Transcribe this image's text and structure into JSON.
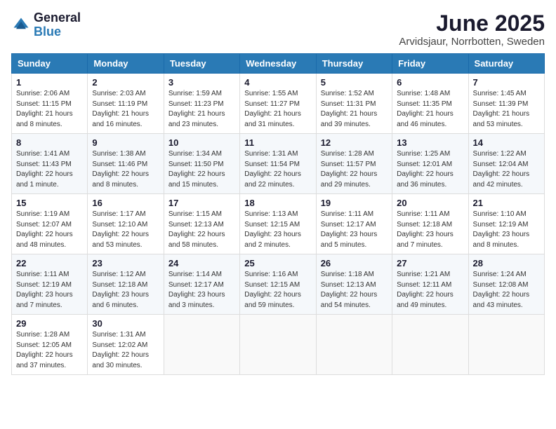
{
  "logo": {
    "general": "General",
    "blue": "Blue"
  },
  "title": "June 2025",
  "location": "Arvidsjaur, Norrbotten, Sweden",
  "days_of_week": [
    "Sunday",
    "Monday",
    "Tuesday",
    "Wednesday",
    "Thursday",
    "Friday",
    "Saturday"
  ],
  "weeks": [
    [
      {
        "day": "1",
        "sunrise": "Sunrise: 2:06 AM",
        "sunset": "Sunset: 11:15 PM",
        "daylight": "Daylight: 21 hours and 8 minutes."
      },
      {
        "day": "2",
        "sunrise": "Sunrise: 2:03 AM",
        "sunset": "Sunset: 11:19 PM",
        "daylight": "Daylight: 21 hours and 16 minutes."
      },
      {
        "day": "3",
        "sunrise": "Sunrise: 1:59 AM",
        "sunset": "Sunset: 11:23 PM",
        "daylight": "Daylight: 21 hours and 23 minutes."
      },
      {
        "day": "4",
        "sunrise": "Sunrise: 1:55 AM",
        "sunset": "Sunset: 11:27 PM",
        "daylight": "Daylight: 21 hours and 31 minutes."
      },
      {
        "day": "5",
        "sunrise": "Sunrise: 1:52 AM",
        "sunset": "Sunset: 11:31 PM",
        "daylight": "Daylight: 21 hours and 39 minutes."
      },
      {
        "day": "6",
        "sunrise": "Sunrise: 1:48 AM",
        "sunset": "Sunset: 11:35 PM",
        "daylight": "Daylight: 21 hours and 46 minutes."
      },
      {
        "day": "7",
        "sunrise": "Sunrise: 1:45 AM",
        "sunset": "Sunset: 11:39 PM",
        "daylight": "Daylight: 21 hours and 53 minutes."
      }
    ],
    [
      {
        "day": "8",
        "sunrise": "Sunrise: 1:41 AM",
        "sunset": "Sunset: 11:43 PM",
        "daylight": "Daylight: 22 hours and 1 minute."
      },
      {
        "day": "9",
        "sunrise": "Sunrise: 1:38 AM",
        "sunset": "Sunset: 11:46 PM",
        "daylight": "Daylight: 22 hours and 8 minutes."
      },
      {
        "day": "10",
        "sunrise": "Sunrise: 1:34 AM",
        "sunset": "Sunset: 11:50 PM",
        "daylight": "Daylight: 22 hours and 15 minutes."
      },
      {
        "day": "11",
        "sunrise": "Sunrise: 1:31 AM",
        "sunset": "Sunset: 11:54 PM",
        "daylight": "Daylight: 22 hours and 22 minutes."
      },
      {
        "day": "12",
        "sunrise": "Sunrise: 1:28 AM",
        "sunset": "Sunset: 11:57 PM",
        "daylight": "Daylight: 22 hours and 29 minutes."
      },
      {
        "day": "13",
        "sunrise": "Sunrise: 1:25 AM",
        "sunset": "Sunset: 12:01 AM",
        "daylight": "Daylight: 22 hours and 36 minutes."
      },
      {
        "day": "14",
        "sunrise": "Sunrise: 1:22 AM",
        "sunset": "Sunset: 12:04 AM",
        "daylight": "Daylight: 22 hours and 42 minutes."
      }
    ],
    [
      {
        "day": "15",
        "sunrise": "Sunrise: 1:19 AM",
        "sunset": "Sunset: 12:07 AM",
        "daylight": "Daylight: 22 hours and 48 minutes."
      },
      {
        "day": "16",
        "sunrise": "Sunrise: 1:17 AM",
        "sunset": "Sunset: 12:10 AM",
        "daylight": "Daylight: 22 hours and 53 minutes."
      },
      {
        "day": "17",
        "sunrise": "Sunrise: 1:15 AM",
        "sunset": "Sunset: 12:13 AM",
        "daylight": "Daylight: 22 hours and 58 minutes."
      },
      {
        "day": "18",
        "sunrise": "Sunrise: 1:13 AM",
        "sunset": "Sunset: 12:15 AM",
        "daylight": "Daylight: 23 hours and 2 minutes."
      },
      {
        "day": "19",
        "sunrise": "Sunrise: 1:11 AM",
        "sunset": "Sunset: 12:17 AM",
        "daylight": "Daylight: 23 hours and 5 minutes."
      },
      {
        "day": "20",
        "sunrise": "Sunrise: 1:11 AM",
        "sunset": "Sunset: 12:18 AM",
        "daylight": "Daylight: 23 hours and 7 minutes."
      },
      {
        "day": "21",
        "sunrise": "Sunrise: 1:10 AM",
        "sunset": "Sunset: 12:19 AM",
        "daylight": "Daylight: 23 hours and 8 minutes."
      }
    ],
    [
      {
        "day": "22",
        "sunrise": "Sunrise: 1:11 AM",
        "sunset": "Sunset: 12:19 AM",
        "daylight": "Daylight: 23 hours and 7 minutes."
      },
      {
        "day": "23",
        "sunrise": "Sunrise: 1:12 AM",
        "sunset": "Sunset: 12:18 AM",
        "daylight": "Daylight: 23 hours and 6 minutes."
      },
      {
        "day": "24",
        "sunrise": "Sunrise: 1:14 AM",
        "sunset": "Sunset: 12:17 AM",
        "daylight": "Daylight: 23 hours and 3 minutes."
      },
      {
        "day": "25",
        "sunrise": "Sunrise: 1:16 AM",
        "sunset": "Sunset: 12:15 AM",
        "daylight": "Daylight: 22 hours and 59 minutes."
      },
      {
        "day": "26",
        "sunrise": "Sunrise: 1:18 AM",
        "sunset": "Sunset: 12:13 AM",
        "daylight": "Daylight: 22 hours and 54 minutes."
      },
      {
        "day": "27",
        "sunrise": "Sunrise: 1:21 AM",
        "sunset": "Sunset: 12:11 AM",
        "daylight": "Daylight: 22 hours and 49 minutes."
      },
      {
        "day": "28",
        "sunrise": "Sunrise: 1:24 AM",
        "sunset": "Sunset: 12:08 AM",
        "daylight": "Daylight: 22 hours and 43 minutes."
      }
    ],
    [
      {
        "day": "29",
        "sunrise": "Sunrise: 1:28 AM",
        "sunset": "Sunset: 12:05 AM",
        "daylight": "Daylight: 22 hours and 37 minutes."
      },
      {
        "day": "30",
        "sunrise": "Sunrise: 1:31 AM",
        "sunset": "Sunset: 12:02 AM",
        "daylight": "Daylight: 22 hours and 30 minutes."
      },
      null,
      null,
      null,
      null,
      null
    ]
  ]
}
